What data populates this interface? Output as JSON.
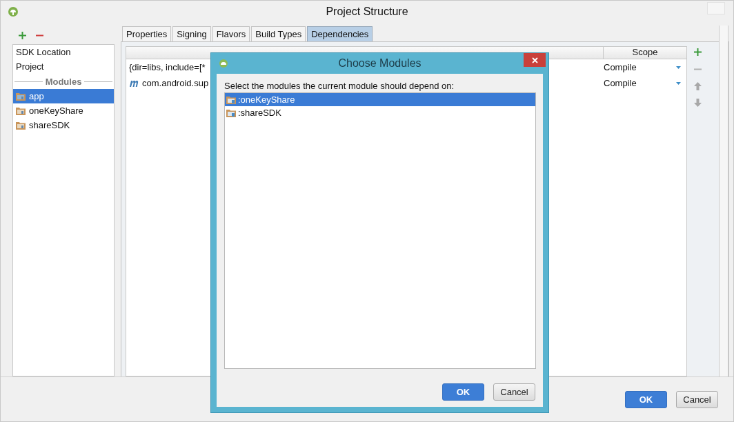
{
  "window": {
    "title": "Project Structure"
  },
  "sidebar": {
    "items": [
      {
        "kind": "item",
        "label": "SDK Location",
        "selected": false
      },
      {
        "kind": "item",
        "label": "Project",
        "selected": false
      },
      {
        "kind": "header",
        "label": "Modules"
      },
      {
        "kind": "module",
        "label": "app",
        "selected": true
      },
      {
        "kind": "module",
        "label": "oneKeyShare",
        "selected": false
      },
      {
        "kind": "module",
        "label": "shareSDK",
        "selected": false
      }
    ]
  },
  "tabs": [
    {
      "label": "Properties",
      "selected": false
    },
    {
      "label": "Signing",
      "selected": false
    },
    {
      "label": "Flavors",
      "selected": false
    },
    {
      "label": "Build Types",
      "selected": false
    },
    {
      "label": "Dependencies",
      "selected": true
    }
  ],
  "table": {
    "columns": [
      "Scope"
    ],
    "rows": [
      {
        "kind": "files",
        "name": "{dir=libs, include=[*",
        "scope": "Compile"
      },
      {
        "kind": "maven",
        "name": "com.android.sup",
        "scope": "Compile"
      }
    ]
  },
  "buttons": [
    "OK",
    "Cancel"
  ],
  "dialog": {
    "title": "Choose Modules",
    "prompt": "Select the modules the current module should depend on:",
    "items": [
      {
        "label": ":oneKeyShare",
        "selected": true
      },
      {
        "label": ":shareSDK",
        "selected": false
      }
    ],
    "buttons": [
      "OK",
      "Cancel"
    ]
  }
}
